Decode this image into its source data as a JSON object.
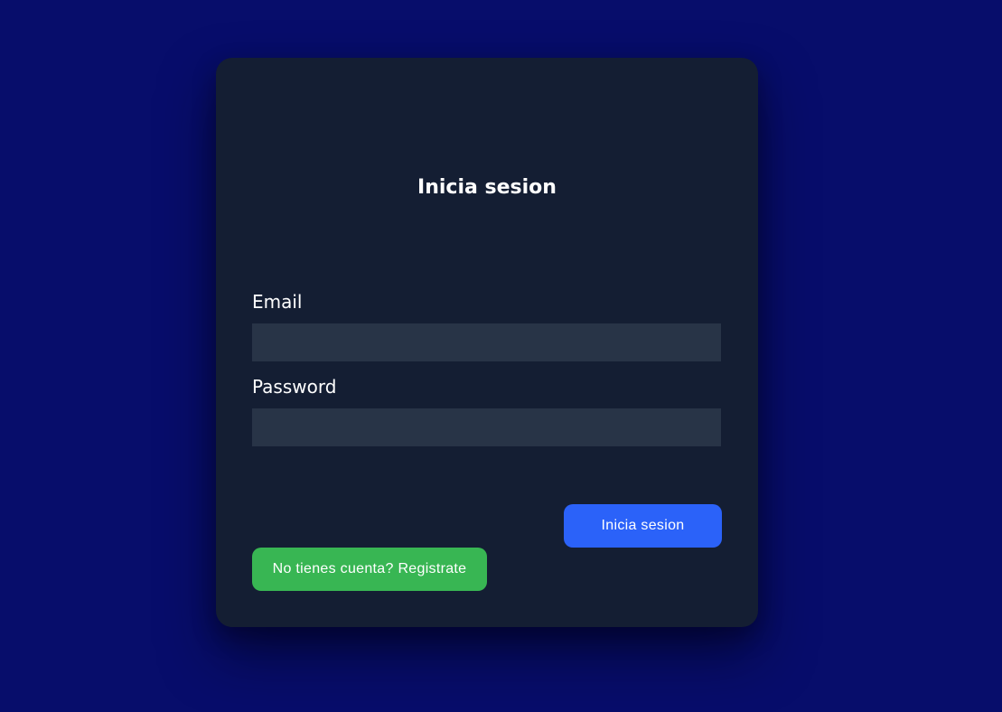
{
  "login": {
    "title": "Inicia sesion",
    "email_label": "Email",
    "email_value": "",
    "password_label": "Password",
    "password_value": "",
    "submit_label": "Inicia sesion",
    "register_label": "No tienes cuenta? Registrate"
  },
  "colors": {
    "background": "#070d6b",
    "card": "#141e33",
    "input": "#283447",
    "primary_button": "#2b62f9",
    "register_button": "#38b653",
    "text": "#ffffff"
  }
}
